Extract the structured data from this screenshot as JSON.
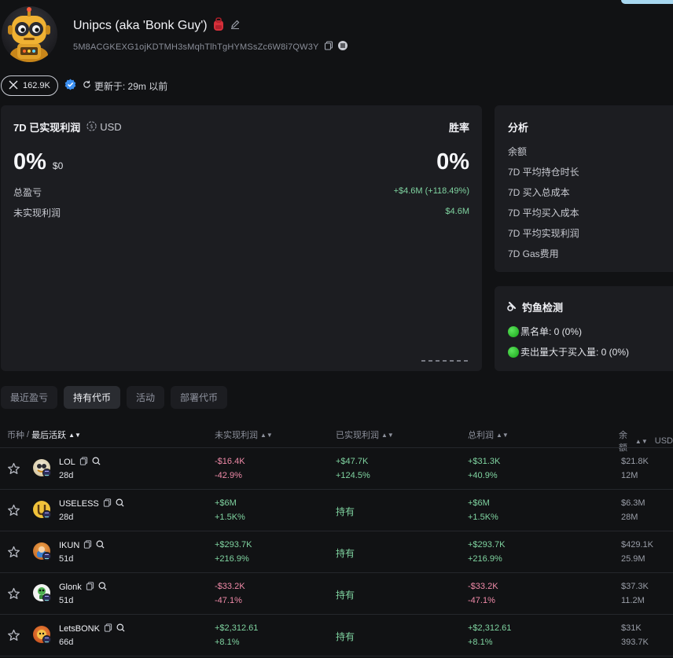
{
  "profile": {
    "name": "Unipcs (aka 'Bonk Guy')",
    "address": "5M8ACGKEXG1ojKDTMH3sMqhTlhTgHYMSsZc6W8i7QW3Y",
    "twitter_followers": "162.9K",
    "updated_label": "更新于: 29m 以前"
  },
  "pnl": {
    "title": "7D 已实现利润",
    "currency": "USD",
    "winrate_label": "胜率",
    "realized_pct": "0%",
    "realized_usd": "$0",
    "winrate_value": "0%",
    "total_pnl_label": "总盈亏",
    "total_pnl_value": "+$4.6M (+118.49%)",
    "unrealized_label": "未实现利润",
    "unrealized_value": "$4.6M"
  },
  "analysis": {
    "title": "分析",
    "items": [
      "余额",
      "7D 平均持仓时长",
      "7D 买入总成本",
      "7D 平均买入成本",
      "7D 平均实现利润",
      "7D Gas费用"
    ]
  },
  "phishing": {
    "title": "钓鱼检测",
    "items": [
      "黑名单: 0 (0%)",
      "卖出量大于买入量: 0 (0%)"
    ]
  },
  "tabs": [
    "最近盈亏",
    "持有代币",
    "活动",
    "部署代币"
  ],
  "active_tab": 1,
  "table": {
    "headers": {
      "token": "币种",
      "last_active": "最后活跃",
      "unrealized": "未实现利润",
      "realized": "已实现利润",
      "total": "总利润",
      "balance": "余额",
      "balance_unit": "USD"
    },
    "hold_label": "持有",
    "rows": [
      {
        "symbol": "LOL",
        "age": "28d",
        "unreal_usd": "-$16.4K",
        "unreal_pct": "-42.9%",
        "real_usd": "+$47.7K",
        "real_pct": "+124.5%",
        "total_usd": "+$31.3K",
        "total_pct": "+40.9%",
        "balance_usd": "$21.8K",
        "balance_amt": "12M"
      },
      {
        "symbol": "USELESS",
        "age": "28d",
        "unreal_usd": "+$6M",
        "unreal_pct": "+1.5K%",
        "real_usd": "",
        "real_pct": "",
        "total_usd": "+$6M",
        "total_pct": "+1.5K%",
        "balance_usd": "$6.3M",
        "balance_amt": "28M"
      },
      {
        "symbol": "IKUN",
        "age": "51d",
        "unreal_usd": "+$293.7K",
        "unreal_pct": "+216.9%",
        "real_usd": "",
        "real_pct": "",
        "total_usd": "+$293.7K",
        "total_pct": "+216.9%",
        "balance_usd": "$429.1K",
        "balance_amt": "25.9M"
      },
      {
        "symbol": "Glonk",
        "age": "51d",
        "unreal_usd": "-$33.2K",
        "unreal_pct": "-47.1%",
        "real_usd": "",
        "real_pct": "",
        "total_usd": "-$33.2K",
        "total_pct": "-47.1%",
        "balance_usd": "$37.3K",
        "balance_amt": "11.2M"
      },
      {
        "symbol": "LetsBONK",
        "age": "66d",
        "unreal_usd": "+$2,312.61",
        "unreal_pct": "+8.1%",
        "real_usd": "",
        "real_pct": "",
        "total_usd": "+$2,312.61",
        "total_pct": "+8.1%",
        "balance_usd": "$31K",
        "balance_amt": "393.7K"
      }
    ]
  },
  "colors": {
    "background": "#111214",
    "card": "#1c1d21",
    "positive": "#7fd3a0",
    "negative": "#f08aa8"
  }
}
